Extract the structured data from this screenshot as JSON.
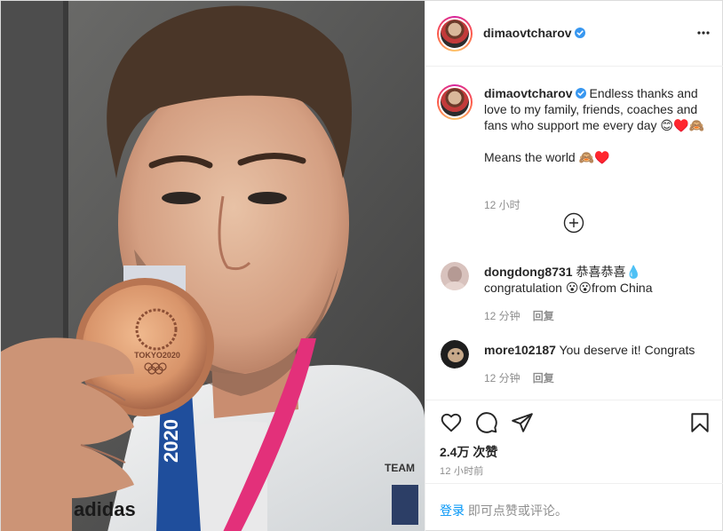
{
  "post": {
    "username": "dimaovtcharov",
    "more_icon": "more-horizontal-icon",
    "verified_color": "#3897f0",
    "caption": {
      "username": "dimaovtcharov",
      "line1": "Endless thanks and love to my family, friends, coaches and fans who support me every day 😊♥️🙈",
      "line2": "Means the world 🙈♥️",
      "time": "12 小时"
    },
    "load_more_icon": "plus-circle-icon",
    "comments": [
      {
        "username": "dongdong8731",
        "text": "恭喜恭喜💧 congratulation 😮😮from China",
        "time": "12 分钟",
        "reply": "回复"
      },
      {
        "username": "more102187",
        "text": "You deserve it! Congrats",
        "time": "12 分钟",
        "reply": "回复"
      }
    ],
    "actions": {
      "like_icon": "heart-icon",
      "comment_icon": "comment-icon",
      "share_icon": "send-icon",
      "save_icon": "bookmark-icon"
    },
    "likes": "2.4万 次赞",
    "post_time": "12 小时前",
    "login": {
      "link": "登录",
      "text": "即可点赞或评论。"
    }
  },
  "photo": {
    "medal_text": "TOKYO2020",
    "ribbon_text": "2020",
    "shirt_brand": "adidas",
    "jacket_text": "TEAM"
  }
}
